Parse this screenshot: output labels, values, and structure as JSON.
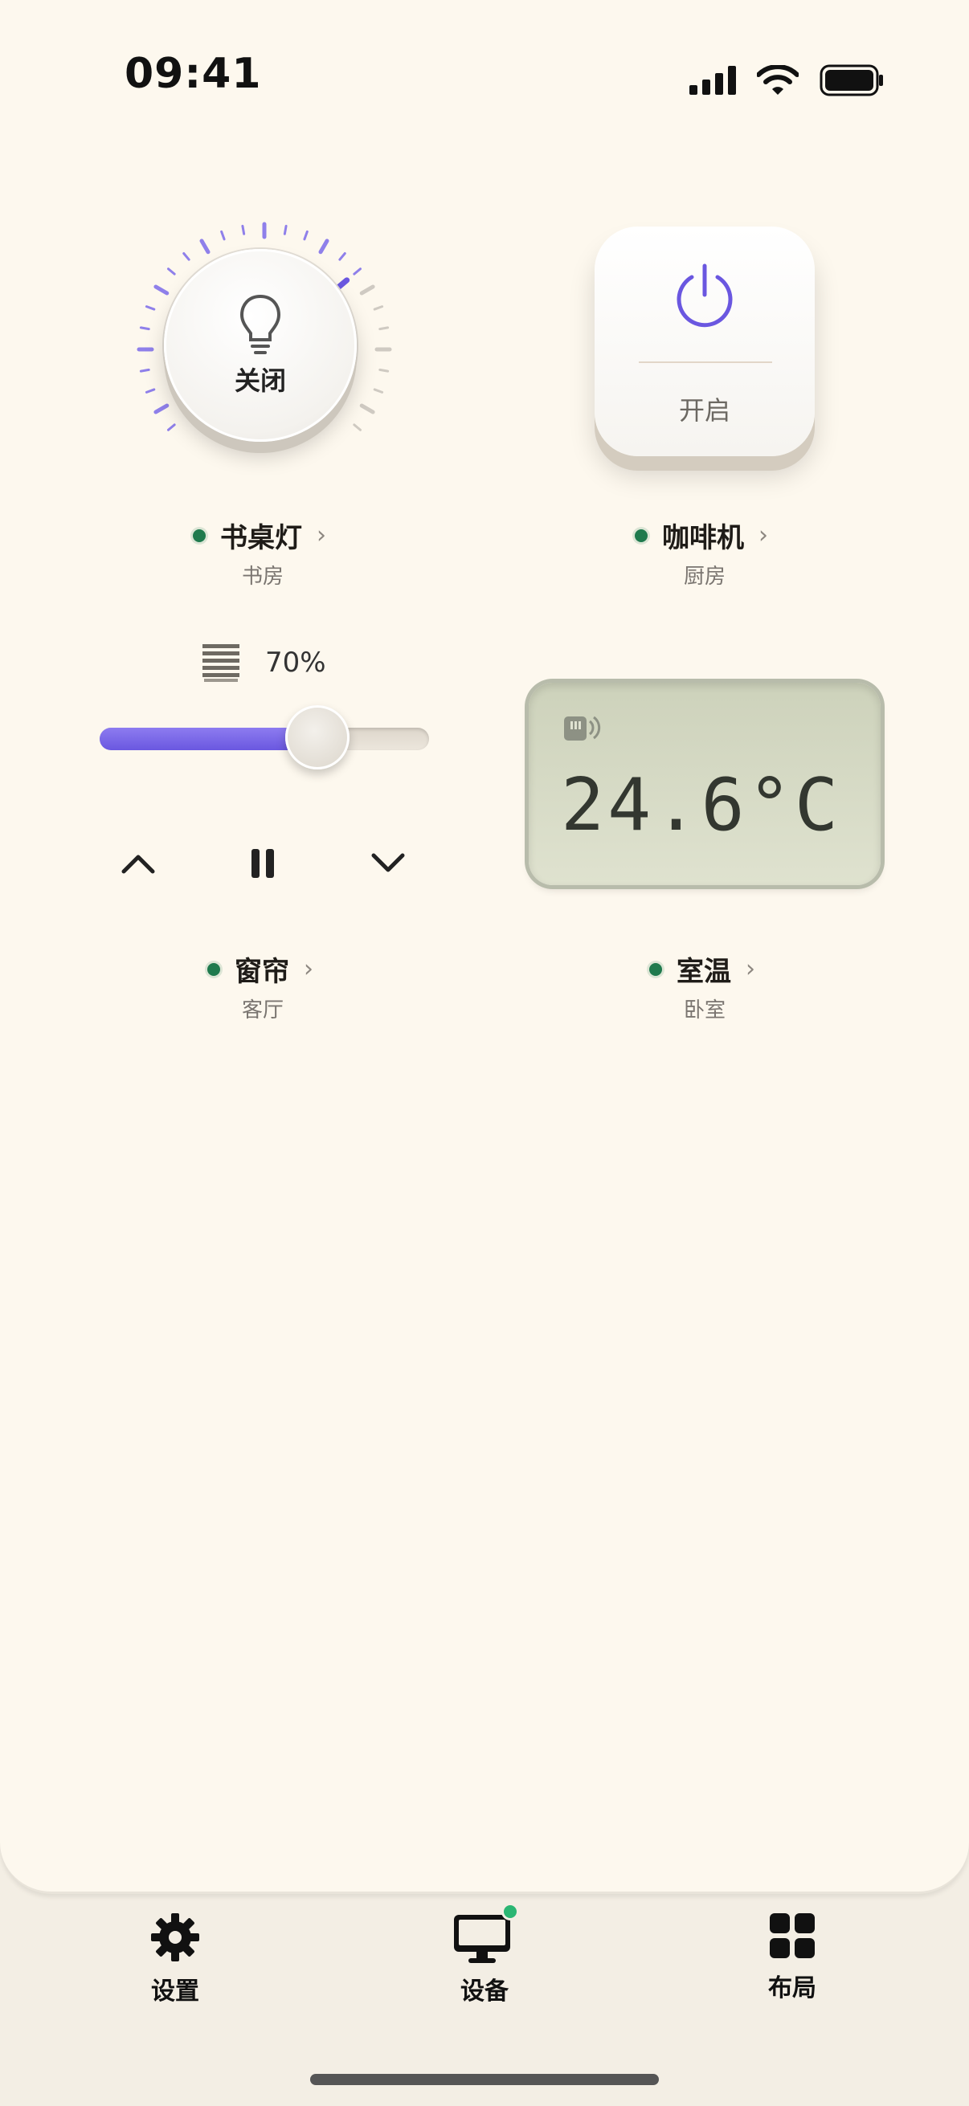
{
  "status_bar": {
    "time": "09:41"
  },
  "devices": {
    "lamp": {
      "name": "书桌灯",
      "room": "书房",
      "state_label": "关闭"
    },
    "coffee": {
      "name": "咖啡机",
      "room": "厨房",
      "state_label": "开启"
    },
    "curtain": {
      "name": "窗帘",
      "room": "客厅",
      "percent_label": "70%",
      "open_fraction": 0.7
    },
    "thermo": {
      "name": "室温",
      "room": "卧室",
      "temperature": "24.6°C"
    }
  },
  "tabs": [
    {
      "label": "设置",
      "icon": "gear-icon"
    },
    {
      "label": "设备",
      "icon": "monitor-icon",
      "badge": true
    },
    {
      "label": "布局",
      "icon": "grid-icon"
    }
  ],
  "colors": {
    "accent": "#6a57e0",
    "status_online": "#1f7a4d",
    "badge": "#2bb673",
    "background": "#fdf8ee"
  }
}
